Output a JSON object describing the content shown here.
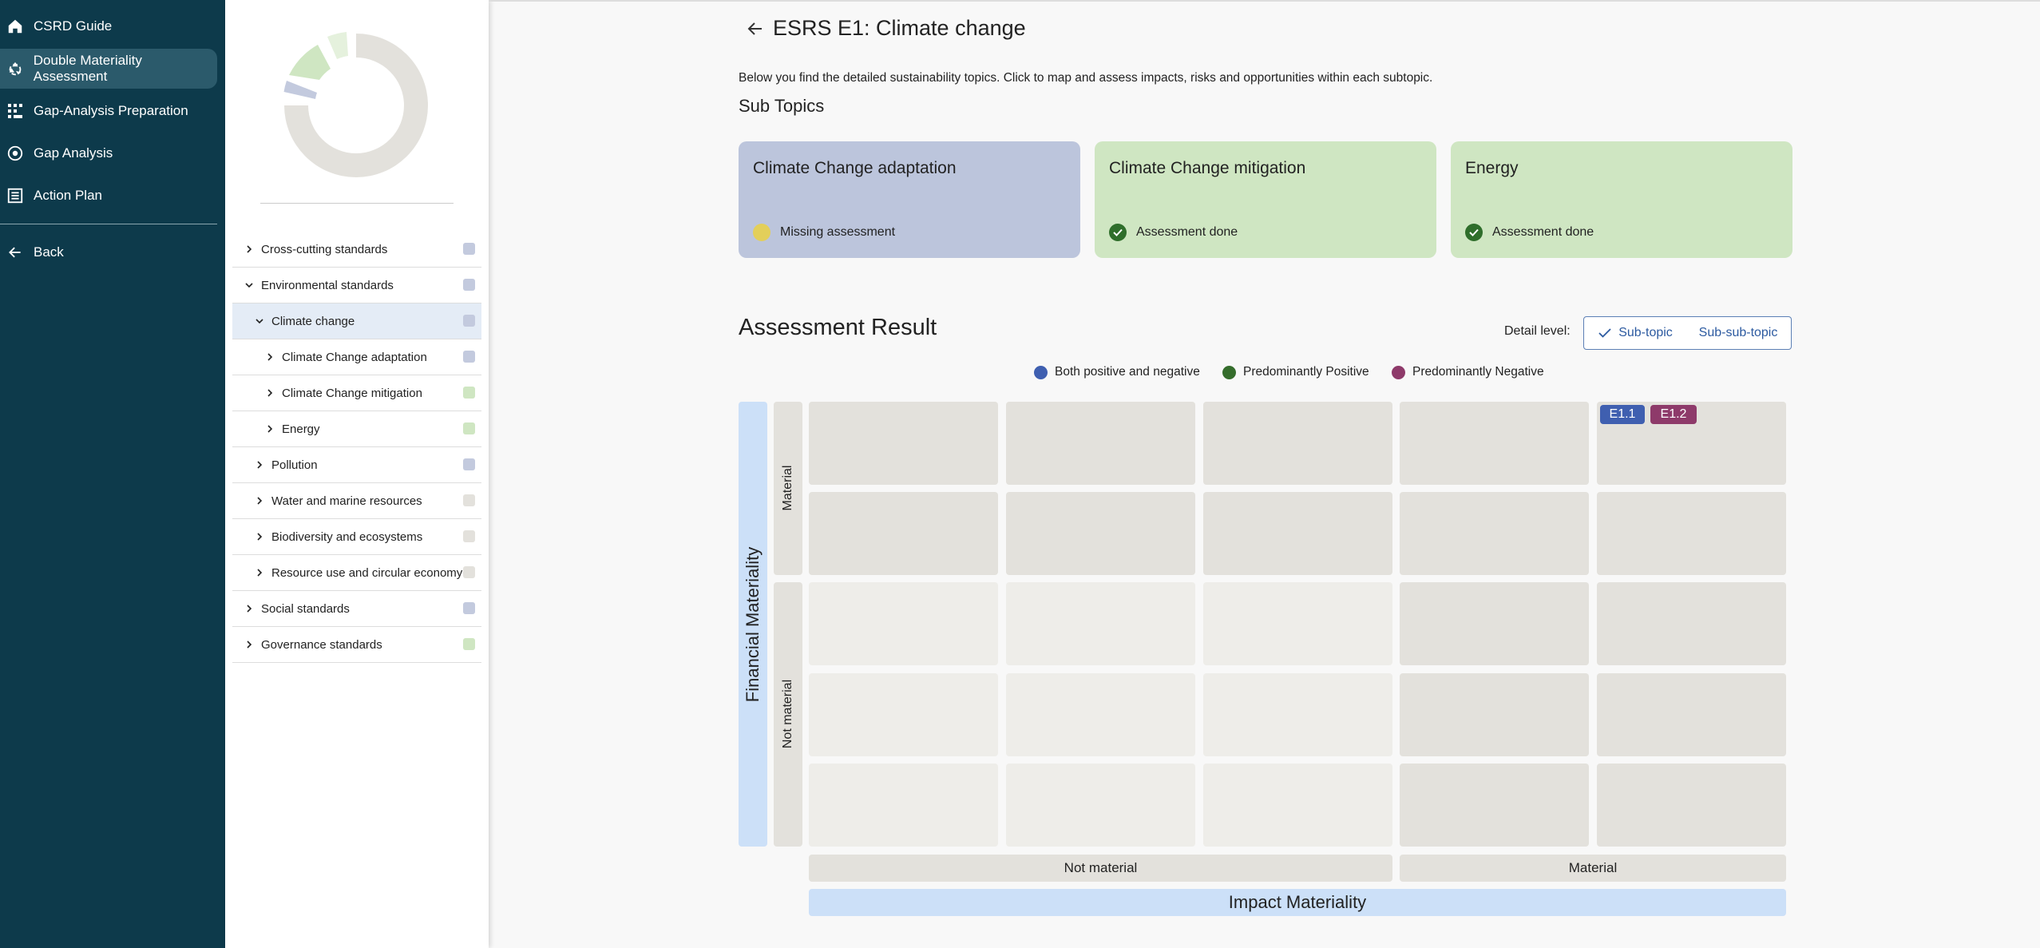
{
  "nav": {
    "items": [
      {
        "label": "CSRD Guide",
        "icon": "home-icon"
      },
      {
        "label": "Double Materiality Assessment",
        "icon": "recycle-icon"
      },
      {
        "label": "Gap-Analysis Preparation",
        "icon": "grid-icon"
      },
      {
        "label": "Gap Analysis",
        "icon": "target-icon"
      },
      {
        "label": "Action Plan",
        "icon": "list-icon"
      }
    ],
    "back_label": "Back"
  },
  "tree": {
    "rows": [
      {
        "label": "Cross-cutting standards",
        "color": "#c3cade"
      },
      {
        "label": "Environmental standards",
        "color": "#c3cade"
      },
      {
        "label": "Climate change",
        "color": "#c3cade"
      },
      {
        "label": "Climate Change adaptation",
        "color": "#c3cade"
      },
      {
        "label": "Climate Change mitigation",
        "color": "#cfe6c2"
      },
      {
        "label": "Energy",
        "color": "#cfe6c2"
      },
      {
        "label": "Pollution",
        "color": "#c3cade"
      },
      {
        "label": "Water and marine resources",
        "color": "#e3e1dc"
      },
      {
        "label": "Biodiversity and ecosystems",
        "color": "#e3e1dc"
      },
      {
        "label": "Resource use and circular economy",
        "color": "#e3e1dc"
      },
      {
        "label": "Social standards",
        "color": "#c3cade"
      },
      {
        "label": "Governance standards",
        "color": "#cfe6c2"
      }
    ]
  },
  "page": {
    "title": "ESRS E1: Climate change",
    "intro": "Below you find the detailed sustainability topics. Click to map and assess impacts, risks and opportunities within each subtopic.",
    "subtopics_heading": "Sub Topics"
  },
  "cards": [
    {
      "title": "Climate Change adaptation",
      "status": "Missing assessment",
      "bg": "#bcc5dc",
      "status_color": "#e3cf5a"
    },
    {
      "title": "Climate Change mitigation",
      "status": "Assessment done",
      "bg": "#cfe6c2",
      "status_color": "#2f6e2b"
    },
    {
      "title": "Energy",
      "status": "Assessment done",
      "bg": "#cfe6c2",
      "status_color": "#2f6e2b"
    }
  ],
  "result": {
    "heading": "Assessment Result",
    "detail_label": "Detail level:",
    "detail_options": [
      "Sub-topic",
      "Sub-sub-topic"
    ],
    "detail_selected": "Sub-topic",
    "legend": [
      {
        "label": "Both positive and negative",
        "color": "#3f5fb0"
      },
      {
        "label": "Predominantly Positive",
        "color": "#356d2c"
      },
      {
        "label": "Predominantly Negative",
        "color": "#8e3a6a"
      }
    ],
    "y_axis_label": "Financial Materiality",
    "y_material": "Material",
    "y_not_material": "Not material",
    "x_axis_label": "Impact Materiality",
    "x_not_material": "Not material",
    "x_material": "Material",
    "badges": [
      {
        "label": "E1.1",
        "color": "#3f5fb0"
      },
      {
        "label": "E1.2",
        "color": "#8e3a6a"
      }
    ]
  }
}
